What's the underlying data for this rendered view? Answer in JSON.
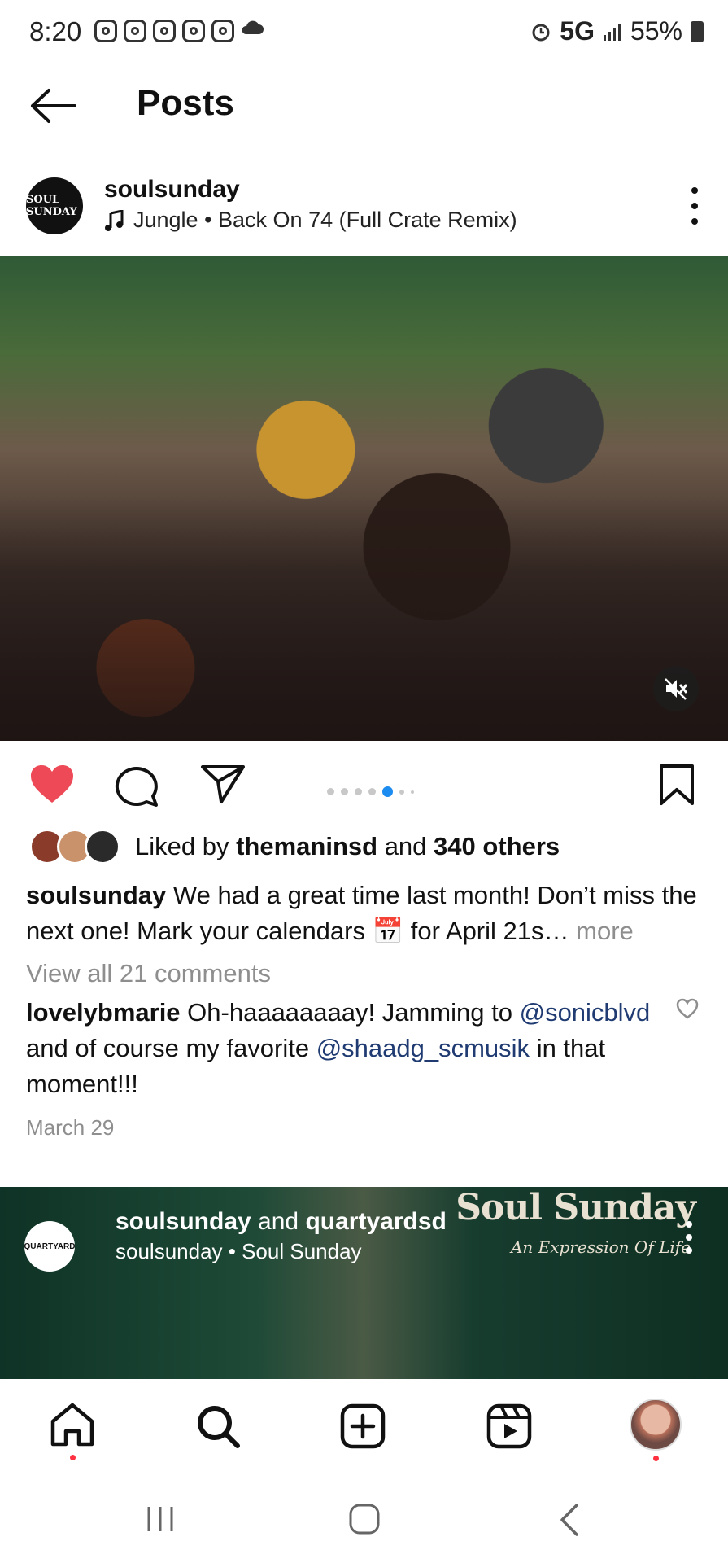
{
  "status_bar": {
    "time": "8:20",
    "network": "5G",
    "battery": "55%"
  },
  "header": {
    "title": "Posts"
  },
  "post": {
    "username": "soulsunday",
    "avatar_text": "SOUL SUNDAY",
    "music": "Jungle • Back On 74 (Full Crate Remix)",
    "carousel": {
      "count": 6,
      "active_index": 3
    },
    "likes": {
      "prefix": "Liked by",
      "user": "themaninsd",
      "middle": "and",
      "others": "340 others"
    },
    "caption": {
      "user": "soulsunday",
      "text": "We had a great time last month! Don’t miss the next one! Mark your calendars 📅 for April 21s…",
      "more": "more"
    },
    "view_all": "View all 21 comments",
    "comment": {
      "user": "lovelybmarie",
      "text1": "Oh-haaaaaaaay! Jamming to",
      "mention1": "@sonicblvd",
      "text2": "and of course my favorite",
      "mention2": "@shaadg_scmusik",
      "text3": "in that moment!!!"
    },
    "date": "March 29"
  },
  "next_post": {
    "user1": "soulsunday",
    "and": "and",
    "user2": "quartyardsd",
    "subtitle": "soulsunday • Soul Sunday",
    "brand": "Soul Sunday",
    "tagline": "An Expression Of Life",
    "avatar_text": "QUARTYARD"
  },
  "colors": {
    "like_red": "#ed4956",
    "active_dot": "#1d8cf0",
    "mention": "#1f3b72"
  }
}
